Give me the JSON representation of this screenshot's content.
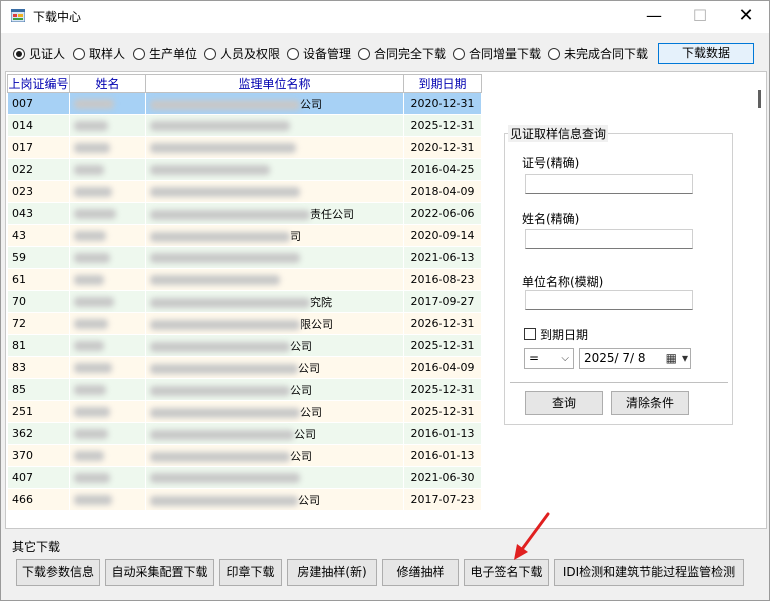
{
  "window": {
    "title": "下载中心",
    "minimize_glyph": "—",
    "maximize_glyph": "☐",
    "close_glyph": "✕"
  },
  "mode_radios": [
    {
      "label": "见证人",
      "checked": true
    },
    {
      "label": "取样人",
      "checked": false
    },
    {
      "label": "生产单位",
      "checked": false
    },
    {
      "label": "人员及权限",
      "checked": false
    },
    {
      "label": "设备管理",
      "checked": false
    },
    {
      "label": "合同完全下载",
      "checked": false
    },
    {
      "label": "合同增量下载",
      "checked": false
    },
    {
      "label": "未完成合同下载",
      "checked": false
    }
  ],
  "download_data_label": "下载数据",
  "grid": {
    "columns": [
      "上岗证编号",
      "姓名",
      "监理单位名称",
      "到期日期"
    ],
    "rows": [
      {
        "id": "007",
        "unit_tail": "公司",
        "date": "2020-12-31"
      },
      {
        "id": "014",
        "unit_tail": "",
        "date": "2025-12-31"
      },
      {
        "id": "017",
        "unit_tail": "",
        "date": "2020-12-31"
      },
      {
        "id": "022",
        "unit_tail": "",
        "date": "2016-04-25"
      },
      {
        "id": "023",
        "unit_tail": "",
        "date": "2018-04-09"
      },
      {
        "id": "043",
        "unit_tail": "责任公司",
        "date": "2022-06-06"
      },
      {
        "id": "43",
        "unit_tail": "司",
        "date": "2020-09-14"
      },
      {
        "id": "59",
        "unit_tail": "",
        "date": "2021-06-13"
      },
      {
        "id": "61",
        "unit_tail": "",
        "date": "2016-08-23"
      },
      {
        "id": "70",
        "unit_tail": "究院",
        "date": "2017-09-27"
      },
      {
        "id": "72",
        "unit_tail": "限公司",
        "date": "2026-12-31"
      },
      {
        "id": "81",
        "unit_tail": "公司",
        "date": "2025-12-31"
      },
      {
        "id": "83",
        "unit_tail": "公司",
        "date": "2016-04-09"
      },
      {
        "id": "85",
        "unit_tail": "公司",
        "date": "2025-12-31"
      },
      {
        "id": "251",
        "unit_tail": "公司",
        "date": "2025-12-31"
      },
      {
        "id": "362",
        "unit_tail": "公司",
        "date": "2016-01-13"
      },
      {
        "id": "370",
        "unit_tail": "公司",
        "date": "2016-01-13"
      },
      {
        "id": "407",
        "unit_tail": "",
        "date": "2021-06-30"
      },
      {
        "id": "466",
        "unit_tail": "公司",
        "date": "2017-07-23"
      }
    ]
  },
  "query": {
    "group_title": "见证取样信息查询",
    "cert_label": "证号(精确)",
    "cert_value": "",
    "name_label": "姓名(精确)",
    "name_value": "",
    "unit_label": "单位名称(模糊)",
    "unit_value": "",
    "expiry_label": "到期日期",
    "expiry_checked": false,
    "operator": "=",
    "date_value": "2025/ 7/ 8",
    "search_label": "查询",
    "clear_label": "清除条件"
  },
  "other_downloads": {
    "title": "其它下载",
    "buttons": [
      "下载参数信息",
      "自动采集配置下载",
      "印章下载",
      "房建抽样(新)",
      "修缮抽样",
      "电子签名下载",
      "IDI检测和建筑节能过程监管检测"
    ]
  },
  "icons": {
    "combo_arrow": "⌵",
    "calendar": "▦",
    "dropdown": "▾"
  },
  "colors": {
    "selected_row": "#a7d1f5",
    "odd_row": "#fff9ec",
    "even_row": "#eef8ee",
    "header_text": "#0000b0",
    "annotation_arrow": "#e02020"
  }
}
